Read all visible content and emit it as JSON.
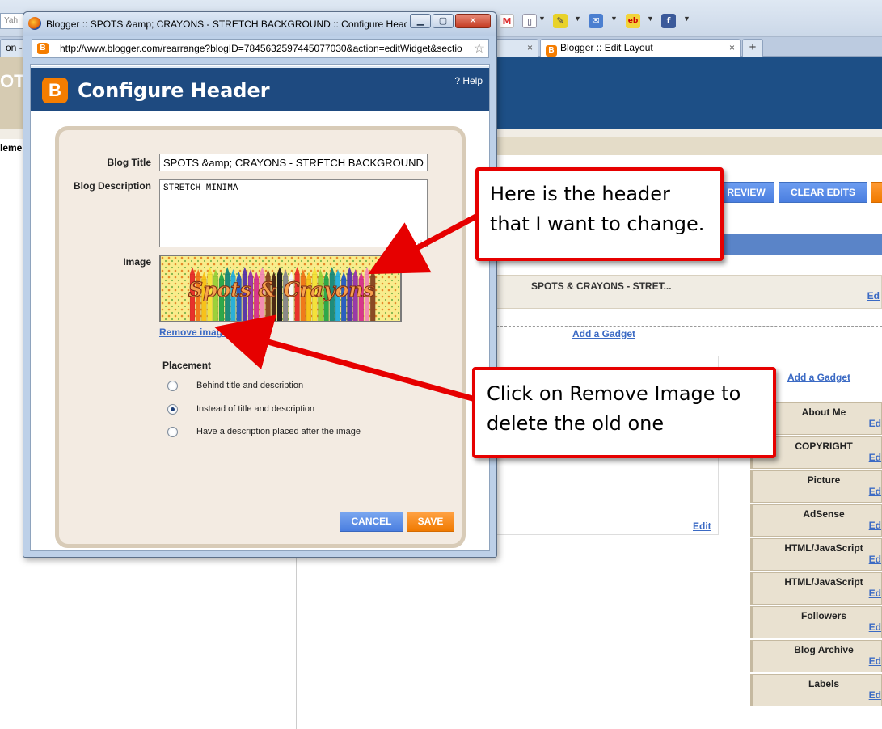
{
  "bg_browser": {
    "search_stub": "Yah",
    "tab_left_stub": "on - Y",
    "tab_active_label": "Blogger :: Edit Layout",
    "left_pane_stub": "OT",
    "left_label_stub": "leme",
    "toolbar_icons": [
      "gmail-icon",
      "page-icon",
      "notes-icon",
      "mail-icon",
      "ebay-icon",
      "facebook-icon"
    ]
  },
  "bg_layout": {
    "preview_btn": "REVIEW",
    "clear_edits_btn": "CLEAR EDITS",
    "header_widget_title": "SPOTS & CRAYONS - STRET...",
    "edit_label": "Edit",
    "edit_stub": "Ed",
    "add_gadget": "Add a Gadget",
    "sidebar_gadgets": [
      "About Me",
      "COPYRIGHT",
      "Picture",
      "AdSense",
      "HTML/JavaScript",
      "HTML/JavaScript",
      "Followers",
      "Blog Archive",
      "Labels"
    ]
  },
  "popup": {
    "window_title": "Blogger :: SPOTS &amp; CRAYONS - STRETCH BACKGROUND :: Configure Header...",
    "url": "http://www.blogger.com/rearrange?blogID=7845632597445077030&action=editWidget&sectio",
    "dialog_title": "Configure Header",
    "help": "? Help",
    "form": {
      "blog_title_label": "Blog Title",
      "blog_title_value": "SPOTS &amp; CRAYONS - STRETCH BACKGROUND",
      "blog_description_label": "Blog Description",
      "blog_description_value": "STRETCH MINIMA",
      "image_label": "Image",
      "header_image_text": "Spots & Crayons",
      "remove_image": "Remove image",
      "placement_label": "Placement",
      "placement_options": [
        {
          "label": "Behind title and description",
          "selected": false
        },
        {
          "label": "Instead of title and description",
          "selected": true
        },
        {
          "label": "Have a description placed after the image",
          "selected": false
        }
      ],
      "cancel": "CANCEL",
      "save": "SAVE"
    }
  },
  "callouts": {
    "header_line1": "Here is the header",
    "header_line2": "that I want to change.",
    "remove_line1": "Click on Remove Image to",
    "remove_line2": "delete the old one"
  },
  "colors": {
    "blogger_orange": "#f57d00",
    "callout_red": "#e60000",
    "header_blue": "#1e4a80",
    "link_blue": "#3b6ac4"
  }
}
